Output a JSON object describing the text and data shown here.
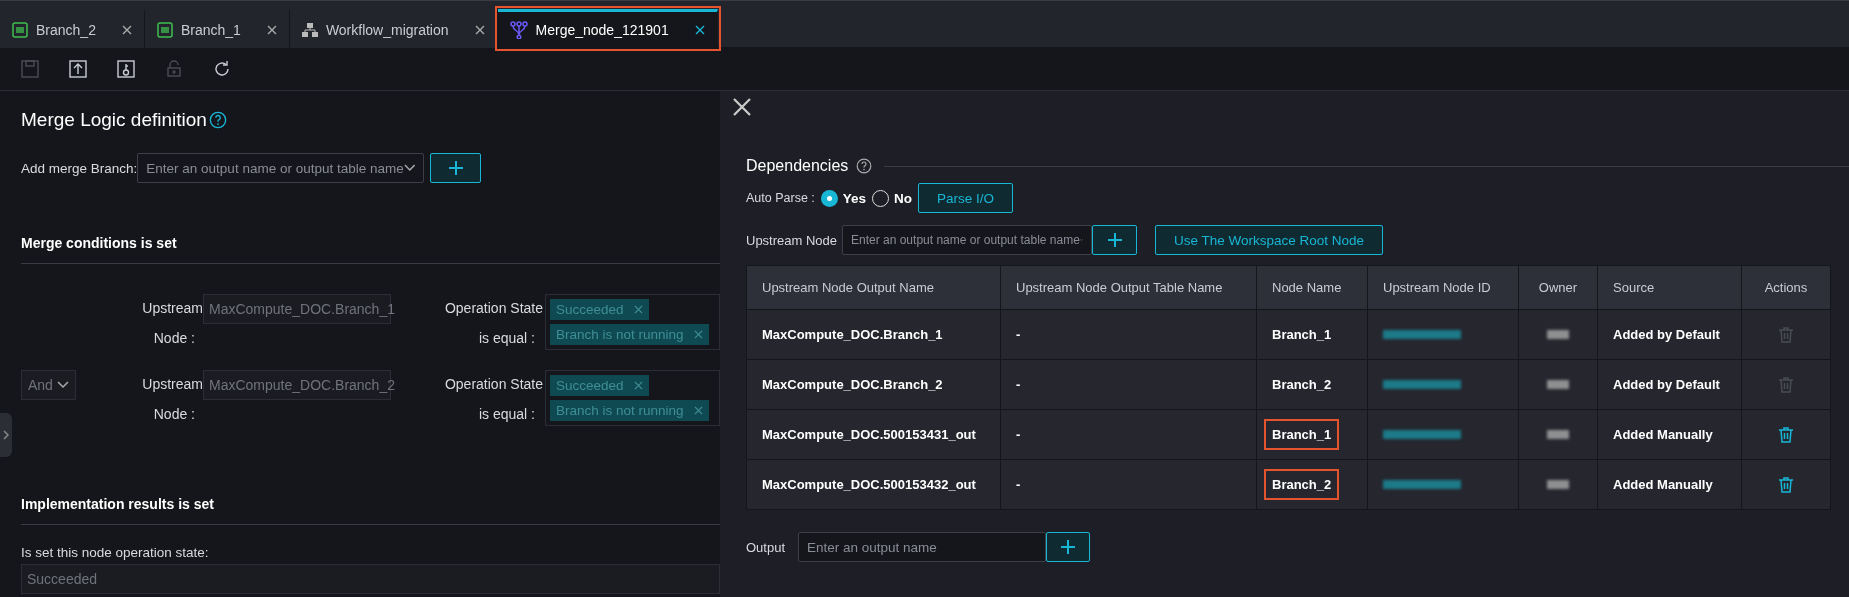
{
  "tabs": [
    {
      "label": "Branch_2",
      "kind": "sql",
      "selected": false,
      "highlighted": false
    },
    {
      "label": "Branch_1",
      "kind": "sql",
      "selected": false,
      "highlighted": false
    },
    {
      "label": "Workflow_migration",
      "kind": "workflow",
      "selected": false,
      "highlighted": false
    },
    {
      "label": "Merge_node_121901",
      "kind": "merge",
      "selected": true,
      "highlighted": true
    }
  ],
  "toolbar": [
    {
      "kind": "save",
      "disabled": true
    },
    {
      "kind": "submit",
      "disabled": false
    },
    {
      "kind": "deploy",
      "disabled": false
    },
    {
      "kind": "lock",
      "disabled": true
    },
    {
      "kind": "refresh",
      "disabled": false
    }
  ],
  "merge_logic": {
    "title": "Merge Logic definition",
    "add_branch_label": "Add merge Branch:",
    "add_branch_placeholder": "Enter an output name or output table name",
    "conditions_title": "Merge conditions is set",
    "conditions": [
      {
        "upstream_label": "Upstream",
        "node_label": "Node :",
        "node_value": "MaxCompute_DOC.Branch_1",
        "state_label": "Operation State",
        "equal_label": "is equal :",
        "tags": [
          "Succeeded",
          "Branch is not running"
        ]
      },
      {
        "operator": "And",
        "upstream_label": "Upstream",
        "node_label": "Node :",
        "node_value": "MaxCompute_DOC.Branch_2",
        "state_label": "Operation State",
        "equal_label": "is equal :",
        "tags": [
          "Succeeded",
          "Branch is not running"
        ]
      }
    ],
    "results_title": "Implementation results is set",
    "state_label": "Is set this node operation state:",
    "state_value": "Succeeded"
  },
  "dependencies": {
    "title": "Dependencies",
    "auto_parse_label": "Auto Parse :",
    "auto_parse_options": [
      {
        "label": "Yes",
        "selected": true
      },
      {
        "label": "No",
        "selected": false
      }
    ],
    "parse_button": "Parse I/O",
    "upstream_label": "Upstream Node",
    "upstream_placeholder": "Enter an output name or output table name",
    "root_button": "Use The Workspace Root Node",
    "columns": [
      "Upstream Node Output Name",
      "Upstream Node Output Table Name",
      "Node Name",
      "Upstream Node ID",
      "Owner",
      "Source",
      "Actions"
    ],
    "rows": [
      {
        "output_name": "MaxCompute_DOC.Branch_1",
        "table_name": "-",
        "node_name": "Branch_1",
        "source": "Added by Default",
        "deletable": false,
        "highlighted": false
      },
      {
        "output_name": "MaxCompute_DOC.Branch_2",
        "table_name": "-",
        "node_name": "Branch_2",
        "source": "Added by Default",
        "deletable": false,
        "highlighted": false
      },
      {
        "output_name": "MaxCompute_DOC.500153431_out",
        "table_name": "-",
        "node_name": "Branch_1",
        "source": "Added Manually",
        "deletable": true,
        "highlighted": true
      },
      {
        "output_name": "MaxCompute_DOC.500153432_out",
        "table_name": "-",
        "node_name": "Branch_2",
        "source": "Added Manually",
        "deletable": true,
        "highlighted": true
      }
    ],
    "output_label": "Output",
    "output_placeholder": "Enter an output name"
  }
}
